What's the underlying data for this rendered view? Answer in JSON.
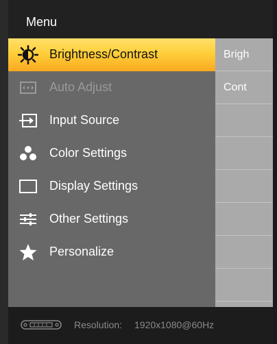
{
  "osd": {
    "title": "Menu",
    "menu_items": [
      {
        "label": "Brightness/Contrast",
        "icon": "brightness-icon",
        "state": "selected"
      },
      {
        "label": "Auto Adjust",
        "icon": "auto-adjust-icon",
        "state": "disabled"
      },
      {
        "label": "Input Source",
        "icon": "input-source-icon",
        "state": "normal"
      },
      {
        "label": "Color Settings",
        "icon": "color-settings-icon",
        "state": "normal"
      },
      {
        "label": "Display Settings",
        "icon": "display-settings-icon",
        "state": "normal"
      },
      {
        "label": "Other Settings",
        "icon": "other-settings-icon",
        "state": "normal"
      },
      {
        "label": "Personalize",
        "icon": "star-icon",
        "state": "normal"
      }
    ],
    "submenu": [
      "Brigh",
      "Cont"
    ],
    "footer": {
      "resolution_label": "Resolution:",
      "resolution_value": "1920x1080@60Hz",
      "icon": "connector-icon"
    },
    "colors": {
      "highlight": "#ffcf3a",
      "panel": "#686868",
      "submenu_panel": "#aaaaaa",
      "header": "#212121"
    }
  }
}
